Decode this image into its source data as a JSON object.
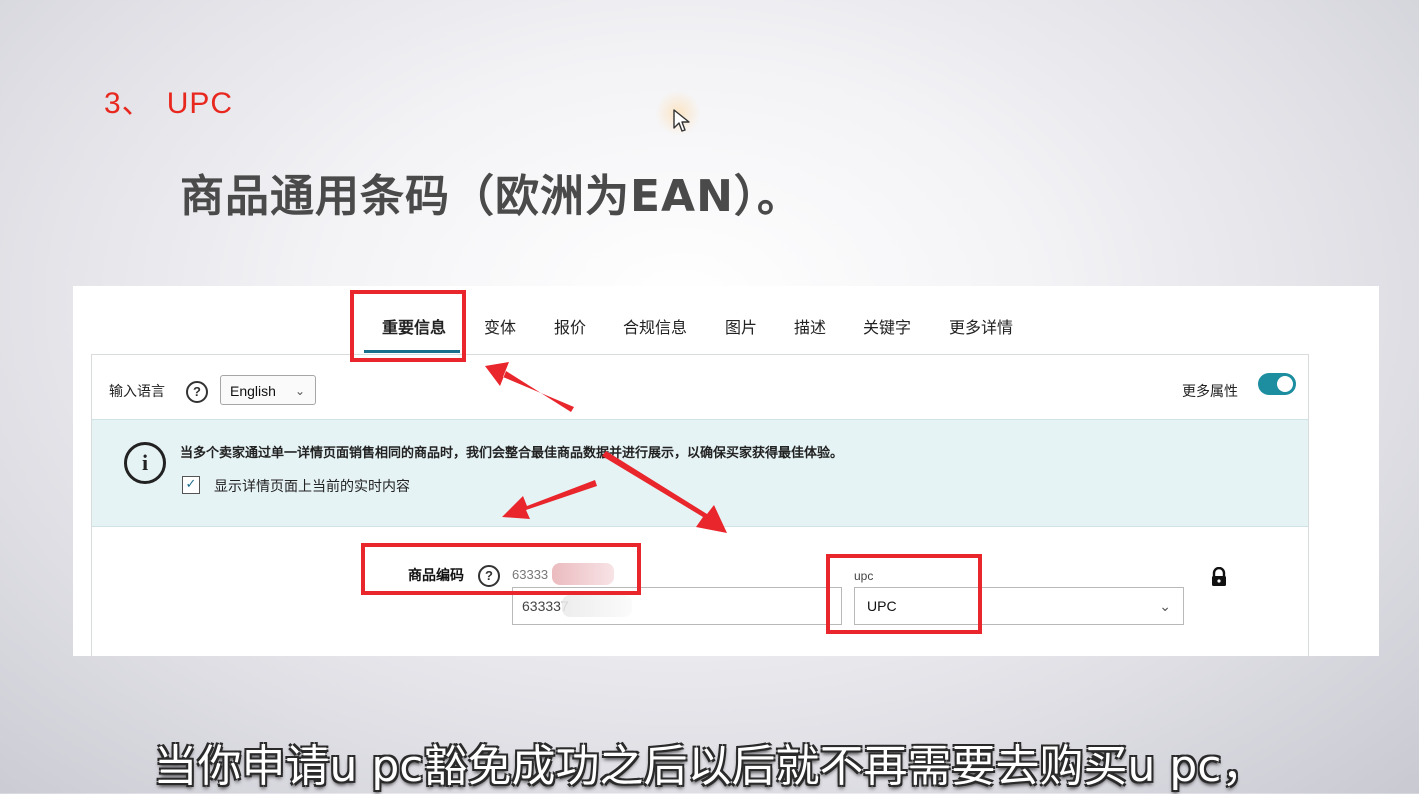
{
  "slide": {
    "number": "3、",
    "heading": "UPC",
    "subtitle": "商品通用条码（欧洲为EAN）。"
  },
  "tabs": [
    {
      "label": "重要信息",
      "active": true
    },
    {
      "label": "变体"
    },
    {
      "label": "报价"
    },
    {
      "label": "合规信息"
    },
    {
      "label": "图片"
    },
    {
      "label": "描述"
    },
    {
      "label": "关键字"
    },
    {
      "label": "更多详情"
    }
  ],
  "language": {
    "label": "输入语言",
    "help_icon": "?",
    "selected": "English"
  },
  "more_attributes": {
    "label": "更多属性",
    "toggle_on": true
  },
  "notice": {
    "icon": "i",
    "text": "当多个卖家通过单一详情页面销售相同的商品时，我们会整合最佳商品数据并进行展示，以确保买家获得最佳体验。",
    "checkbox_label": "显示详情页面上当前的实时内容",
    "checkbox_checked": true
  },
  "product_code": {
    "label": "商品编码",
    "help_icon": "?",
    "hint": "63333",
    "value": "633337"
  },
  "code_type": {
    "label": "upc",
    "selected": "UPC"
  },
  "caption": "当你申请u pc豁免成功之后以后就不再需要去购买u pc，",
  "colors": {
    "accent_red": "#e8262c",
    "toggle_teal": "#1d8ea0",
    "notice_bg": "#e6f3f5"
  }
}
